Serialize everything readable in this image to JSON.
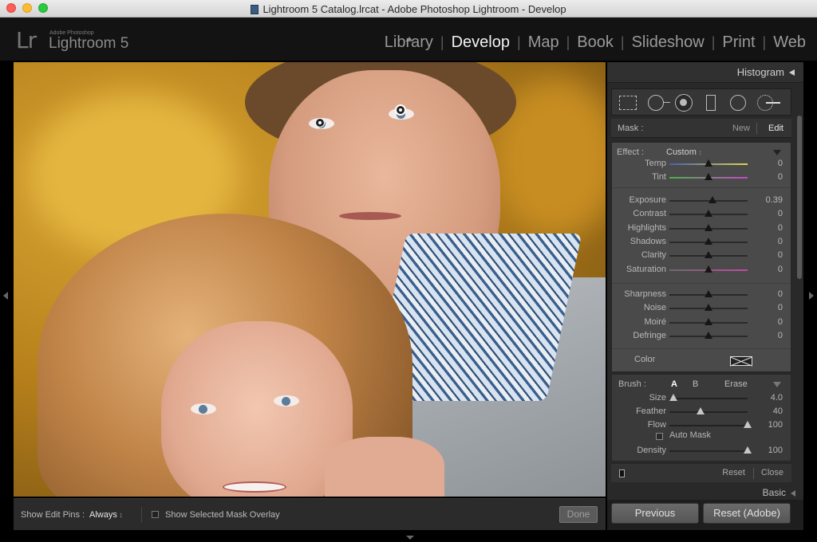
{
  "window": {
    "title": "Lightroom 5 Catalog.lrcat - Adobe Photoshop Lightroom - Develop"
  },
  "identity": {
    "logo": "Lr",
    "vendor": "Adobe Photoshop",
    "product": "Lightroom 5"
  },
  "modules": [
    "Library",
    "Develop",
    "Map",
    "Book",
    "Slideshow",
    "Print",
    "Web"
  ],
  "active_module": "Develop",
  "right_panel": {
    "header": "Histogram",
    "mask": {
      "label": "Mask :",
      "new": "New",
      "edit": "Edit"
    },
    "effect": {
      "label": "Effect :",
      "value": "Custom"
    },
    "white_balance": [
      {
        "label": "Temp",
        "value": "0",
        "level": 0.5
      },
      {
        "label": "Tint",
        "value": "0",
        "level": 0.5
      }
    ],
    "tone": [
      {
        "label": "Exposure",
        "value": "0.39",
        "level": 0.55
      },
      {
        "label": "Contrast",
        "value": "0",
        "level": 0.5
      },
      {
        "label": "Highlights",
        "value": "0",
        "level": 0.5
      },
      {
        "label": "Shadows",
        "value": "0",
        "level": 0.5
      },
      {
        "label": "Clarity",
        "value": "0",
        "level": 0.5
      },
      {
        "label": "Saturation",
        "value": "0",
        "level": 0.5
      }
    ],
    "detail": [
      {
        "label": "Sharpness",
        "value": "0",
        "level": 0.5
      },
      {
        "label": "Noise",
        "value": "0",
        "level": 0.5
      },
      {
        "label": "Moiré",
        "value": "0",
        "level": 0.5
      },
      {
        "label": "Defringe",
        "value": "0",
        "level": 0.5
      }
    ],
    "color_label": "Color",
    "brush": {
      "label": "Brush :",
      "a": "A",
      "b": "B",
      "erase": "Erase",
      "sliders": [
        {
          "label": "Size",
          "value": "4.0",
          "level": 0.05
        },
        {
          "label": "Feather",
          "value": "40",
          "level": 0.4
        },
        {
          "label": "Flow",
          "value": "100",
          "level": 1.0
        }
      ],
      "auto_mask": "Auto Mask",
      "density": {
        "label": "Density",
        "value": "100",
        "level": 1.0
      }
    },
    "reset": "Reset",
    "close": "Close",
    "basic": "Basic"
  },
  "toolbar": {
    "pins_label": "Show Edit Pins :",
    "pins_value": "Always",
    "overlay_label": "Show Selected Mask Overlay",
    "done": "Done"
  },
  "buttons": {
    "previous": "Previous",
    "reset": "Reset (Adobe)"
  },
  "colors": {
    "accent": "#f2f2f2",
    "panel": "#292929",
    "effects_panel": "#4a4a4a"
  }
}
